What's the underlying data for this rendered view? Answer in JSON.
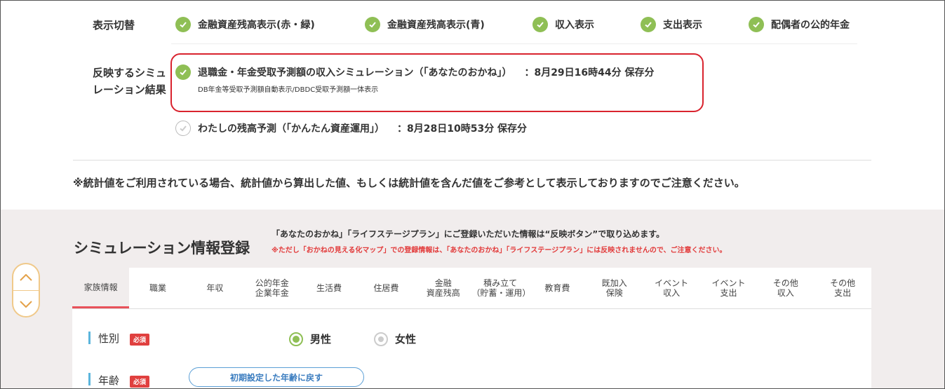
{
  "display_toggle": {
    "label": "表示切替",
    "options": [
      {
        "label": "金融資産残高表示(赤・緑)"
      },
      {
        "label": "金融資産残高表示(青)"
      },
      {
        "label": "収入表示"
      },
      {
        "label": "支出表示"
      },
      {
        "label": "配偶者の公的年金"
      }
    ]
  },
  "sim_results": {
    "label_line1": "反映するシミュ",
    "label_line2": "レーション結果",
    "items": [
      {
        "title": "退職金・年金受取予測額の収入シミュレーション（「あなたのおかね」）",
        "saved": "：8月29日16時44分 保存分",
        "sub": "DB年金等受取予測額自動表示/DBDC受取予測額一体表示",
        "checked": true
      },
      {
        "title": "わたしの残高予測（「かんたん資産運用」）",
        "saved": "：8月28日10時53分 保存分",
        "checked": false
      }
    ]
  },
  "notice": "※統計値をご利用されている場合、統計値から算出した値、もしくは統計値を含んだ値をご参考として表示しておりますのでご注意ください。",
  "sim_register": {
    "title": "シミュレーション情報登録",
    "info": "「あなたのおかね」「ライフステージプラン」にご登録いただいた情報は“反映ボタン”で取り込めます。",
    "warning": "※ただし「おかねの見える化マップ」での登録情報は、「あなたのおかね」「ライフステージプラン」には反映されませんので、ご注意ください。"
  },
  "tabs": [
    {
      "l1": "家族情報",
      "l2": ""
    },
    {
      "l1": "職業",
      "l2": ""
    },
    {
      "l1": "年収",
      "l2": ""
    },
    {
      "l1": "公的年金",
      "l2": "企業年金"
    },
    {
      "l1": "生活費",
      "l2": ""
    },
    {
      "l1": "住居費",
      "l2": ""
    },
    {
      "l1": "金融",
      "l2": "資産残高"
    },
    {
      "l1": "積み立て",
      "l2": "（貯蓄・運用）"
    },
    {
      "l1": "教育費",
      "l2": ""
    },
    {
      "l1": "既加入",
      "l2": "保険"
    },
    {
      "l1": "イベント",
      "l2": "収入"
    },
    {
      "l1": "イベント",
      "l2": "支出"
    },
    {
      "l1": "その他",
      "l2": "収入"
    },
    {
      "l1": "その他",
      "l2": "支出"
    }
  ],
  "form": {
    "gender": {
      "label": "性別",
      "required": "必須",
      "options": [
        "男性",
        "女性"
      ],
      "selected": "男性"
    },
    "age": {
      "label": "年齢",
      "required": "必須",
      "reset_button": "初期設定した年齢に戻す"
    }
  },
  "colors": {
    "check": "#8fbf55",
    "highlight": "#d9232e",
    "tab_active": "#e8515a",
    "field_bar": "#5bb5dc"
  }
}
